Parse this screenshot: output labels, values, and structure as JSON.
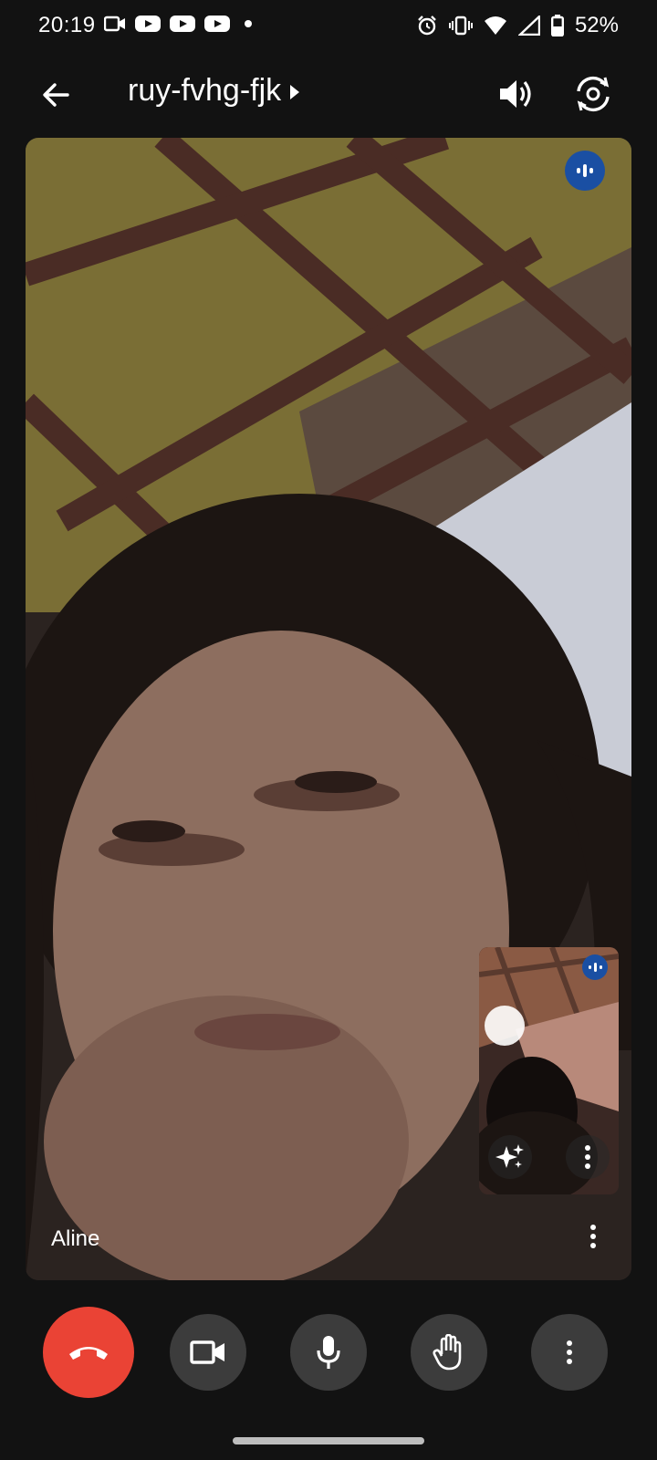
{
  "status_bar": {
    "time": "20:19",
    "battery_percent": "52%",
    "left_icons": [
      "video-call-icon",
      "youtube-icon",
      "youtube-icon",
      "youtube-icon",
      "notification-dot-icon"
    ],
    "right_icons": [
      "alarm-icon",
      "vibrate-icon",
      "wifi-icon",
      "signal-icon",
      "battery-icon"
    ]
  },
  "top_bar": {
    "meeting_code": "ruy-fvhg-fjk",
    "back_icon": "arrow-back-icon",
    "speaker_icon": "speaker-icon",
    "switch_camera_icon": "switch-camera-icon"
  },
  "main_video": {
    "participant_name": "Aline",
    "speaking_indicator_icon": "audio-level-icon",
    "more_icon": "more-vert-icon"
  },
  "self_view": {
    "speaking_indicator_icon": "audio-level-icon",
    "effects_icon": "sparkle-effects-icon",
    "more_icon": "more-vert-icon"
  },
  "controls": {
    "buttons": [
      "end-call-icon",
      "camera-icon",
      "microphone-icon",
      "raise-hand-icon",
      "more-vert-icon"
    ]
  },
  "colors": {
    "background": "#121212",
    "end_call": "#ea4335",
    "control_button": "#3c3c3c",
    "speaking_badge": "#1a4fa3"
  }
}
